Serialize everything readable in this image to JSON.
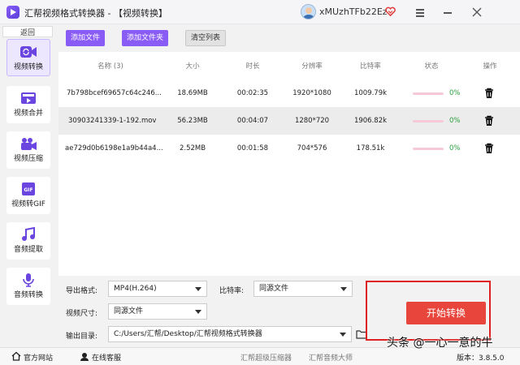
{
  "window": {
    "app_title": "汇帮视频格式转换器 - 【视频转换】",
    "user_name": "xMUzhTFb22Ez",
    "icons": [
      "app-logo-icon",
      "avatar",
      "vip-heart-icon",
      "menu-icon",
      "minimize-icon",
      "close-icon"
    ]
  },
  "sidebar": {
    "back_label": "返回",
    "items": [
      {
        "label": "视频转换",
        "icon": "video-convert-icon",
        "active": true
      },
      {
        "label": "视频合并",
        "icon": "video-merge-icon",
        "active": false
      },
      {
        "label": "视频压缩",
        "icon": "video-compress-icon",
        "active": false
      },
      {
        "label": "视频转GIF",
        "icon": "gif-icon",
        "active": false
      },
      {
        "label": "音频提取",
        "icon": "music-note-icon",
        "active": false
      },
      {
        "label": "音频转换",
        "icon": "microphone-icon",
        "active": false
      }
    ]
  },
  "toolbar": {
    "add_file": "添加文件",
    "add_folder": "添加文件夹",
    "clear_list": "清空列表"
  },
  "table": {
    "headers": {
      "name": "名称 (3)",
      "size": "大小",
      "duration": "时长",
      "resolution": "分辨率",
      "bitrate": "比特率",
      "status": "状态",
      "action": "操作"
    },
    "rows": [
      {
        "name": "7b798bcef69657c64c246...",
        "size": "18.69MB",
        "duration": "00:02:35",
        "resolution": "1920*1080",
        "bitrate": "1009.79k",
        "progress": 0,
        "status": "0%"
      },
      {
        "name": "30903241339-1-192.mov",
        "size": "56.23MB",
        "duration": "00:04:07",
        "resolution": "1280*720",
        "bitrate": "1906.82k",
        "progress": 0,
        "status": "0%"
      },
      {
        "name": "ae729d0b6198e1a9b44a4...",
        "size": "2.52MB",
        "duration": "00:01:58",
        "resolution": "704*576",
        "bitrate": "178.51k",
        "progress": 0,
        "status": "0%"
      }
    ]
  },
  "settings": {
    "format_label": "导出格式:",
    "format_value": "MP4(H.264)",
    "bitrate_label": "比特率:",
    "bitrate_value": "同源文件",
    "size_label": "视频尺寸:",
    "size_value": "同源文件",
    "output_label": "输出目录:",
    "output_value": "C:/Users/汇帮/Desktop/汇帮视频格式转换器",
    "start_button": "开始转换"
  },
  "footer": {
    "website": "官方网站",
    "support": "在线客服",
    "compressor": "汇帮超级压缩器",
    "audio_master": "汇帮音频大师",
    "version": "版本：3.8.5.0"
  },
  "watermark": "头条 @一心一意的牛",
  "colors": {
    "accent_purple": "#8a5cf6",
    "start_red": "#e8453c",
    "highlight_red": "#e02020",
    "progress_pink": "#f5cad6",
    "success_green": "#2a9d3a"
  }
}
